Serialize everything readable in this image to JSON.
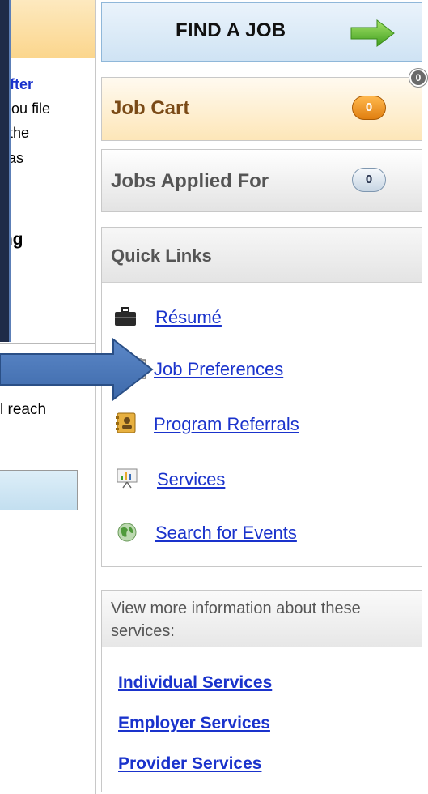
{
  "left": {
    "line_after": "after",
    "line2": "r you file",
    "line3": "n the",
    "line4": "s as",
    "bold_fragment": "ing",
    "reach_fragment": "l reach"
  },
  "find_job": {
    "label": "FIND A JOB",
    "icon": "green-right-arrow"
  },
  "job_cart": {
    "label": "Job Cart",
    "count": "0",
    "badge": "0",
    "accent": "#f19a2c"
  },
  "jobs_applied": {
    "label": "Jobs Applied For",
    "count": "0"
  },
  "quick_links": {
    "title": "Quick Links",
    "items": [
      {
        "label": "Résumé",
        "icon": "briefcase-icon"
      },
      {
        "label": "Job Preferences",
        "icon": "clipboard-icon"
      },
      {
        "label": "Program Referrals",
        "icon": "address-book-icon"
      },
      {
        "label": "Services",
        "icon": "chart-presentation-icon"
      },
      {
        "label": "Search for Events",
        "icon": "globe-icon"
      }
    ]
  },
  "info": {
    "text": "View more information about these services:",
    "links": [
      "Individual Services",
      "Employer Services",
      "Provider Services"
    ]
  },
  "colors": {
    "link": "#1a33cc",
    "annotation_arrow": "#4a76b8",
    "overlay": "#1e2b48"
  }
}
